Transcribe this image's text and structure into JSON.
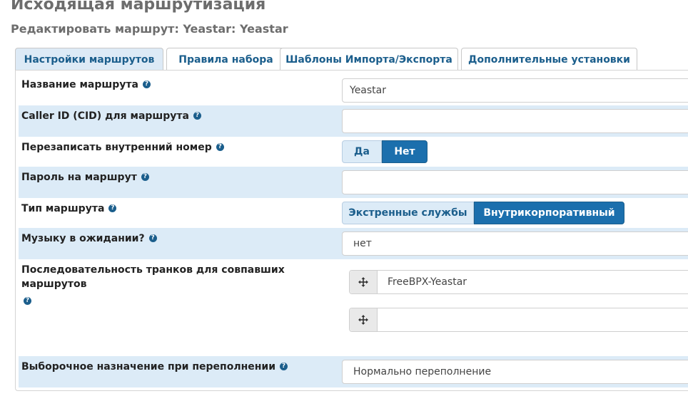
{
  "header": {
    "title": "Исходящая маршрутизация",
    "subtitle": "Редактировать маршрут: Yeastar: Yeastar"
  },
  "tabs": [
    {
      "label": "Настройки маршрутов",
      "active": true
    },
    {
      "label": "Правила набора",
      "active": false
    },
    {
      "label": "Шаблоны Импорта/Экспорта",
      "active": false
    },
    {
      "label": "Дополнительные установки",
      "active": false
    }
  ],
  "form": {
    "route_name": {
      "label": "Название маршрута",
      "value": "Yeastar"
    },
    "route_cid": {
      "label": "Caller ID (CID) для маршрута",
      "value": ""
    },
    "override_extension": {
      "label": "Перезаписать внутренний номер",
      "options": [
        "Да",
        "Нет"
      ],
      "selected": "Нет"
    },
    "route_password": {
      "label": "Пароль на маршрут",
      "value": ""
    },
    "route_type": {
      "label": "Тип маршрута",
      "options": [
        "Экстренные службы",
        "Внутрикорпоративный"
      ],
      "selected": "Внутрикорпоративный"
    },
    "music_on_hold": {
      "label": "Музыку в ожидании?",
      "value": "нет"
    },
    "trunk_sequence": {
      "label_line1": "Последовательность транков для совпавших",
      "label_line2": "маршрутов",
      "trunks": [
        "FreeBPX-Yeastar",
        ""
      ]
    },
    "overflow_destination": {
      "label": "Выборочное назначение при переполнении",
      "value": "Нормально переполнение"
    }
  },
  "colors": {
    "accent": "#1b6fad",
    "row_highlight": "#dcebf7",
    "tab_text": "#1b5e8c",
    "title_gray": "#6d6d6d"
  },
  "icons": {
    "help": "question-circle-icon",
    "drag": "move-arrows-icon"
  }
}
